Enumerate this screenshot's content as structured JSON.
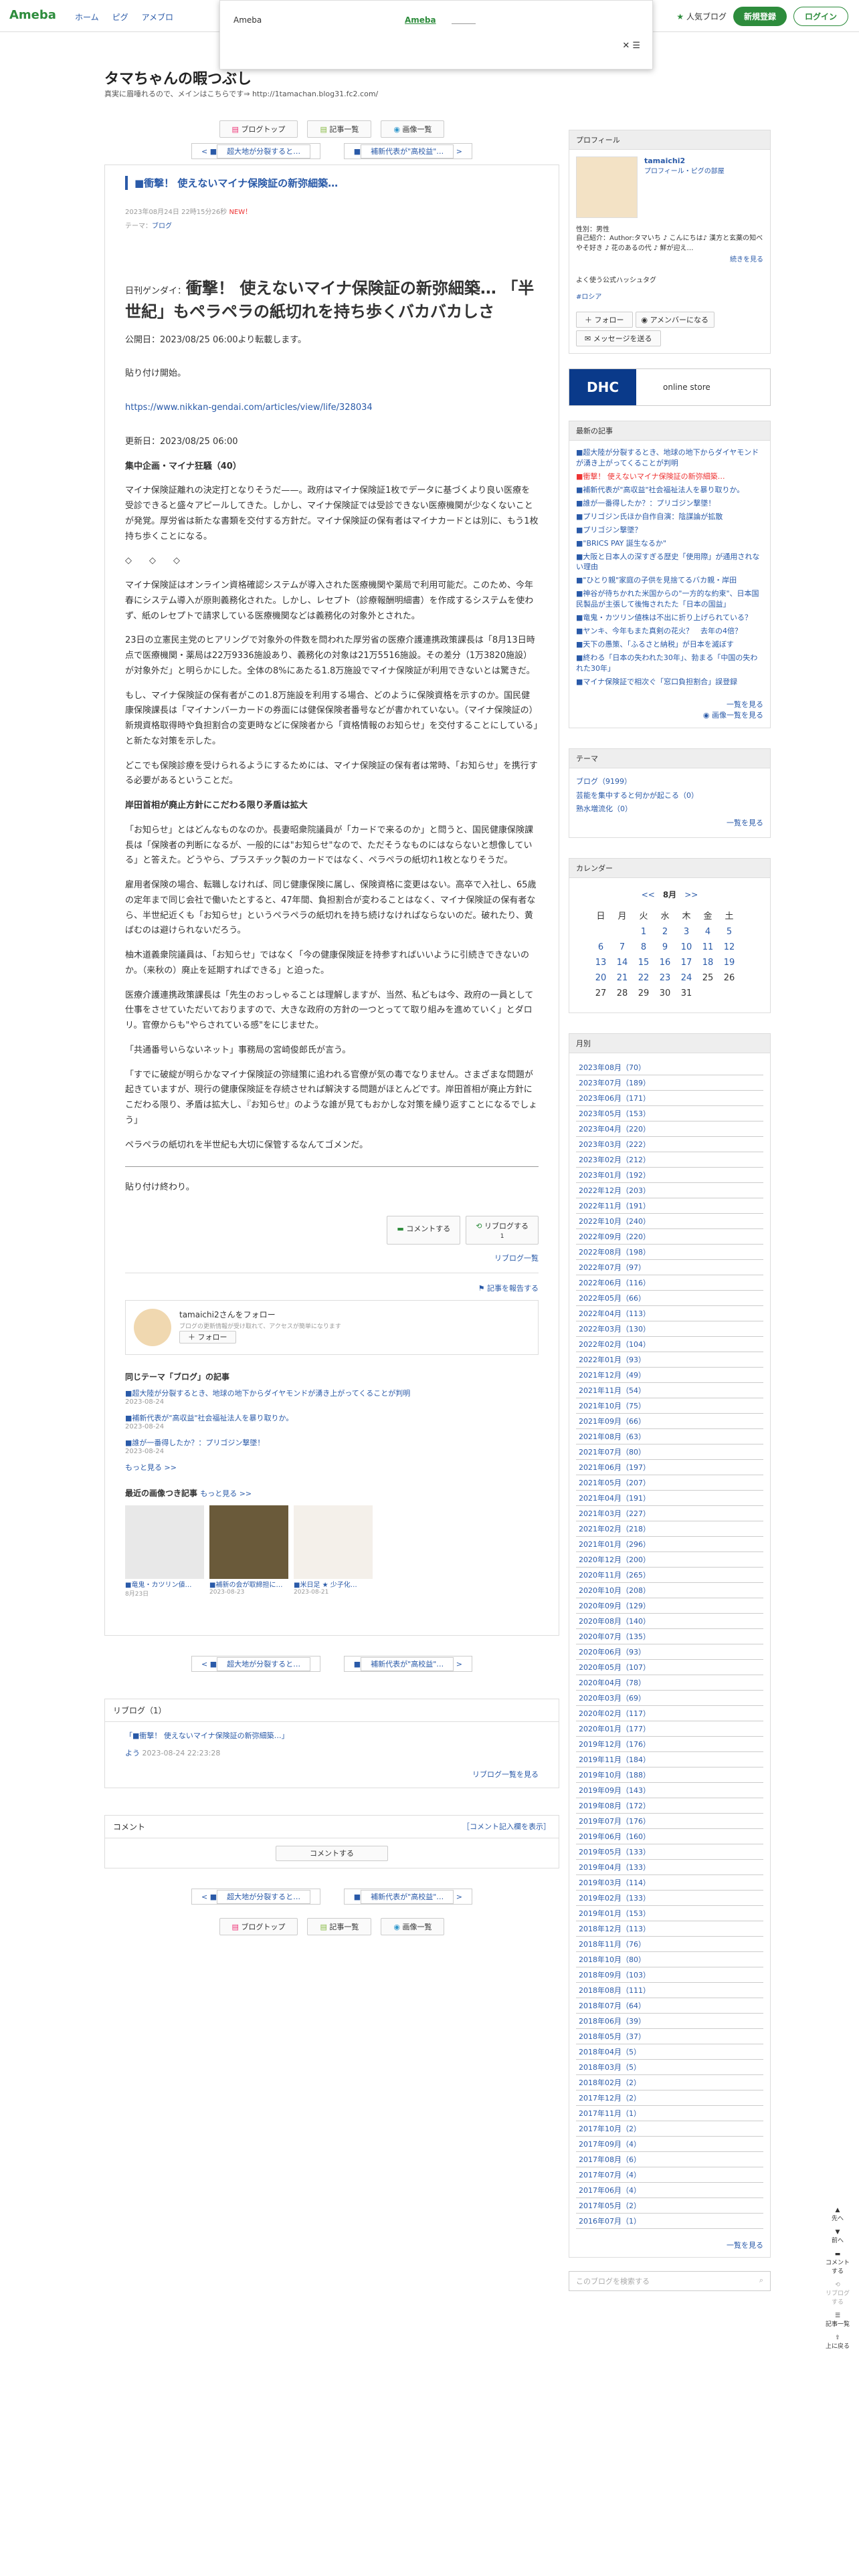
{
  "header": {
    "logo": "Ameba",
    "nav": [
      "ホーム",
      "ピグ",
      "アメブロ"
    ],
    "popular": "人気ブログ",
    "signup": "新規登録",
    "login": "ログイン"
  },
  "banner": {
    "brand": "Ameba",
    "link": "Ameba"
  },
  "blog": {
    "title": "タマちゃんの暇つぶし",
    "desc": "真実に眉唾れるので、メインはこちらです⇒ http://1tamachan.blog31.fc2.com/"
  },
  "nav": {
    "top": "ブログトップ",
    "list": "記事一覧",
    "images": "画像一覧",
    "prev": "超大地が分裂すると…",
    "next": "補新代表が\"高校益\"…"
  },
  "entry": {
    "title": "■衝撃！ 使えないマイナ保険証の新弥細築…",
    "date": "2023年08月24日 22時15分26秒",
    "new": "NEW！",
    "theme_label": "テーマ：",
    "theme": "ブログ",
    "source": "日刊ゲンダイ：",
    "headline": "衝撃！ 使えないマイナ保険証の新弥細築… 「半世紀」もペラペラの紙切れを持ち歩くバカバカしさ",
    "published": "公開日：2023/08/25 06:00より転載します。",
    "intro": "貼り付け開始。",
    "url": "https://www.nikkan-gendai.com/articles/view/life/328034",
    "updated": "更新日：2023/08/25 06:00",
    "series": "集中企画・マイナ狂騒（40）",
    "p1": "マイナ保険証離れの決定打となりそうだ——。政府はマイナ保険証1枚でデータに基づくより良い医療を受診できると盛々アピールしてきた。しかし、マイナ保険証では受診できない医療機関が少なくないことが発覚。厚労省は新たな書類を交付する方針だ。マイナ保険証の保有者はマイナカードとは別に、もう1枚持ち歩くことになる。",
    "dots": "◇　　◇　　◇",
    "p2": "マイナ保険証はオンライン資格確認システムが導入された医療機関や薬局で利用可能だ。このため、今年春にシステム導入が原則義務化された。しかし、レセプト（診療報酬明細書）を作成するシステムを使わず、紙のレセプトで請求している医療機関などは義務化の対象外とされた。",
    "p3": "23日の立憲民主党のヒアリングで対象外の件数を問われた厚労省の医療介護連携政策課長は「8月13日時点で医療機関・薬局は22万9336施設あり、義務化の対象は21万5516施設。その差分（1万3820施設）が対象外だ」と明らかにした。全体の8%にあたる1.8万施設でマイナ保険証が利用できないとは驚きだ。",
    "p4": "もし、マイナ保険証の保有者がこの1.8万施設を利用する場合、どのように保険資格を示すのか。国民健康保険課長は「マイナンバーカードの券面には健保保険者番号などが書かれていない。（マイナ保険証の）新規資格取得時や負担割合の変更時などに保険者から「資格情報のお知らせ」を交付することにしている」と新たな対策を示した。",
    "p5": "どこでも保険診療を受けられるようにするためには、マイナ保険証の保有者は常時、「お知らせ」を携行する必要があるということだ。",
    "h2": "岸田首相が廃止方針にこだわる限り矛盾は拡大",
    "p6": "「お知らせ」とはどんなものなのか。長妻昭衆院議員が「カードで来るのか」と問うと、国民健康保険課長は「保険者の判断になるが、一般的には\"お知らせ\"なので、ただそうなものにはならないと想像している」と答えた。どうやら、プラスチック製のカードではなく、ペラペラの紙切れ1枚となりそうだ。",
    "p7": "雇用者保険の場合、転職しなければ、同じ健康保険に属し、保険資格に変更はない。高卒で入社し、65歳の定年まで同じ会社で働いたとすると、47年間、負担割合が変わることはなく、マイナ保険証の保有者なら、半世紀近くも「お知らせ」というペラペラの紙切れを持ち続けなければならないのだ。破れたり、黄ばむのは避けられないだろう。",
    "p8": "柚木道義衆院議員は、「お知らせ」ではなく「今の健康保険証を持参すればいいように引続きできないのか。（来秋の）廃止を延期すればできる」と迫った。",
    "p9": "医療介護連携政策課長は「先生のおっしゃることは理解しますが、当然、私どもは今、政府の一員として仕事をさせていただいておりますので、大きな政府の方針の一つとってて取り組みを進めていく」とダロリ。官僚からも\"やらされている感\"をにじませた。",
    "p10": "「共通番号いらないネット」事務局の宮崎俊郎氏が言う。",
    "p11": "「すでに破綻が明らかなマイナ保険証の弥縫策に追われる官僚が気の毒でなりません。さまざまな問題が起きていますが、現行の健康保険証を存続させれば解決する問題がほとんどです。岸田首相が廃止方針にこだわる限り、矛盾は拡大し、『お知らせ』のような誰が見てもおかしな対策を繰り返すことになるでしょう」",
    "p12": "ペラペラの紙切れを半世紀も大切に保管するなんてゴメンだ。",
    "outro": "貼り付け終わり。",
    "comment_btn": "コメントする",
    "reblog_btn": "リブログする",
    "reblog_count": "1",
    "reblog_list": "リブログ一覧",
    "report": "記事を報告する",
    "follow_text": "tamaichi2さんをフォロー",
    "follow_sub": "ブログの更新情報が受け取れて、アクセスが簡単になります",
    "follow_btn": "フォロー",
    "same_theme_title": "同じテーマ「ブログ」の記事",
    "same_theme": [
      {
        "title": "■超大陸が分裂するとき、地球の地下からダイヤモンドが湧き上がってくることが判明",
        "date": "2023-08-24"
      },
      {
        "title": "■補新代表が\"高収益\"社会福祉法人を暴り取りか。",
        "date": "2023-08-24"
      },
      {
        "title": "■誰が一番得したか？：プリゴジン撃墜！",
        "date": "2023-08-24"
      }
    ],
    "more": "もっと見る >>",
    "recent_images_title": "最近の画像つき記事",
    "recent_images_more": "もっと見る >>",
    "thumbs": [
      {
        "title": "■竜鬼・カツリン値…",
        "date": "8月23日"
      },
      {
        "title": "■補新の会が取締担に…",
        "date": "2023-08-23"
      },
      {
        "title": "■米日足 ★ 少子化…",
        "date": "2023-08-21"
      }
    ]
  },
  "reblog_box": {
    "title": "リブログ（1）",
    "item": "「■衝撃！ 使えないマイナ保険証の新弥細築…」",
    "user": "よう",
    "date": "2023-08-24 22:23:28",
    "more": "リブログ一覧を見る"
  },
  "comment_box": {
    "title": "コメント",
    "note": "［コメント記入欄を表示］",
    "btn": "コメントする"
  },
  "profile": {
    "title": "プロフィール",
    "name": "tamaichi2",
    "link": "プロフィール・ピグの部屋",
    "gender": "性別：男性",
    "intro": "自己紹介：Author:タマいち ♪ こんにちは♪ 漢方と玄薬の知べやそ好き ♪ 花のあるの代 ♪ 鮮が迎え…",
    "more": "続きを見る",
    "hashtag_title": "よく使う公式ハッシュタグ",
    "hashtag": "#ロシア",
    "follow": "フォロー",
    "member": "アメンバーになる",
    "message": "メッセージを送る"
  },
  "ad": {
    "brand": "DHC",
    "text": "online store"
  },
  "recent": {
    "title": "最新の記事",
    "items": [
      "■超大陸が分裂するとき、地球の地下からダイヤモンドが湧き上がってくることが判明",
      "■衝撃！ 使えないマイナ保険証の新弥細築…",
      "■補新代表が\"高収益\"社会福祉法人を暴り取りか。",
      "■誰が一番得したか？：プリゴジン撃墜！",
      "■プリゴジン氏ほか自作自演：陰謀論が拡散",
      "■プリゴジン撃墜？",
      "■\"BRICS PAY 誕生なるか\"",
      "■大阪と日本人の深すぎる歴史「使用際」が通用されない理由",
      "■\"ひとり親\"家庭の子供を見捨てるバカ親・岸田",
      "■神谷が待ちかれた米国からの\"一方的な約束\"、日本国民製品が主張して後悔されたた「日本の国益」",
      "■竜鬼・カツリン値株は不出に折り上げられている？",
      "■ヤンキ、今年もまた真剣の花火？　去年の4倍？",
      "■天下の愚策、「ふるさと納税」が日本を滅ぼす",
      "■終わる「日本の失われた30年」、勃まる「中国の失われた30年」",
      "■マイナ保険証で相次ぐ「窓口負担割合」誤登録"
    ],
    "list": "一覧を見る",
    "images": "画像一覧を見る"
  },
  "theme": {
    "title": "テーマ",
    "items": [
      "ブログ（9199）",
      "芸能を集中すると何かが起こる（0）",
      "熟水増流化（0）"
    ],
    "list": "一覧を見る"
  },
  "calendar": {
    "title": "カレンダー",
    "month": "8月",
    "prev": "<<",
    "next": ">>",
    "days": [
      "日",
      "月",
      "火",
      "水",
      "木",
      "金",
      "土"
    ],
    "weeks": [
      [
        "",
        "",
        "1",
        "2",
        "3",
        "4",
        "5"
      ],
      [
        "6",
        "7",
        "8",
        "9",
        "10",
        "11",
        "12"
      ],
      [
        "13",
        "14",
        "15",
        "16",
        "17",
        "18",
        "19"
      ],
      [
        "20",
        "21",
        "22",
        "23",
        "24",
        "25",
        "26"
      ],
      [
        "27",
        "28",
        "29",
        "30",
        "31",
        "",
        ""
      ]
    ]
  },
  "monthly": {
    "title": "月別",
    "items": [
      "2023年08月（70）",
      "2023年07月（189）",
      "2023年06月（171）",
      "2023年05月（153）",
      "2023年04月（220）",
      "2023年03月（222）",
      "2023年02月（212）",
      "2023年01月（192）",
      "2022年12月（203）",
      "2022年11月（191）",
      "2022年10月（240）",
      "2022年09月（220）",
      "2022年08月（198）",
      "2022年07月（97）",
      "2022年06月（116）",
      "2022年05月（66）",
      "2022年04月（113）",
      "2022年03月（130）",
      "2022年02月（104）",
      "2022年01月（93）",
      "2021年12月（49）",
      "2021年11月（54）",
      "2021年10月（75）",
      "2021年09月（66）",
      "2021年08月（63）",
      "2021年07月（80）",
      "2021年06月（197）",
      "2021年05月（207）",
      "2021年04月（191）",
      "2021年03月（227）",
      "2021年02月（218）",
      "2021年01月（296）",
      "2020年12月（200）",
      "2020年11月（265）",
      "2020年10月（208）",
      "2020年09月（129）",
      "2020年08月（140）",
      "2020年07月（135）",
      "2020年06月（93）",
      "2020年05月（107）",
      "2020年04月（78）",
      "2020年03月（69）",
      "2020年02月（117）",
      "2020年01月（177）",
      "2019年12月（176）",
      "2019年11月（184）",
      "2019年10月（188）",
      "2019年09月（143）",
      "2019年08月（172）",
      "2019年07月（176）",
      "2019年06月（160）",
      "2019年05月（133）",
      "2019年04月（133）",
      "2019年03月（114）",
      "2019年02月（133）",
      "2019年01月（153）",
      "2018年12月（113）",
      "2018年11月（76）",
      "2018年10月（80）",
      "2018年09月（103）",
      "2018年08月（111）",
      "2018年07月（64）",
      "2018年06月（39）",
      "2018年05月（37）",
      "2018年04月（5）",
      "2018年03月（5）",
      "2018年02月（2）",
      "2017年12月（2）",
      "2017年11月（1）",
      "2017年10月（2）",
      "2017年09月（4）",
      "2017年08月（6）",
      "2017年07月（4）",
      "2017年06月（4）",
      "2017年05月（2）",
      "2016年07月（1）"
    ],
    "list": "一覧を見る"
  },
  "search": {
    "placeholder": "このブログを検索する"
  },
  "floatnav": [
    "先へ",
    "前へ",
    "コメントする",
    "リブログする",
    "記事一覧",
    "上に戻る"
  ]
}
